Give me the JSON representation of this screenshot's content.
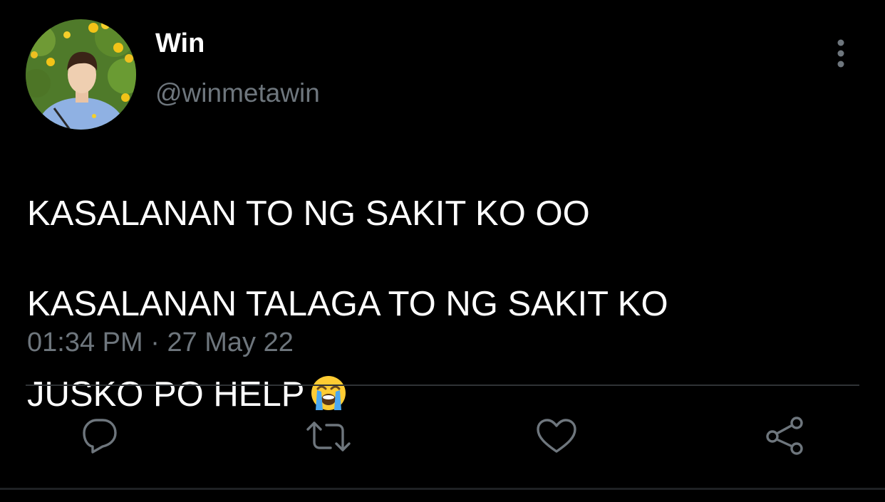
{
  "tweet": {
    "author": {
      "display_name": "Win",
      "handle": "@winmetawin",
      "avatar_icon": "profile-photo"
    },
    "text_lines": [
      "KASALANAN TO NG SAKIT KO OO",
      "KASALANAN TALAGA TO NG SAKIT KO",
      "JUSKO PO HELP"
    ],
    "emoji": "loudly-crying-face",
    "time": "01:34 PM",
    "separator": "·",
    "date": "27 May 22"
  },
  "actions": {
    "reply_icon": "reply-icon",
    "retweet_icon": "retweet-icon",
    "like_icon": "like-icon",
    "share_icon": "share-icon",
    "more_icon": "more-vertical-icon"
  },
  "colors": {
    "background": "#000000",
    "text": "#ffffff",
    "secondary": "#6e767d",
    "divider": "#2f3336"
  }
}
